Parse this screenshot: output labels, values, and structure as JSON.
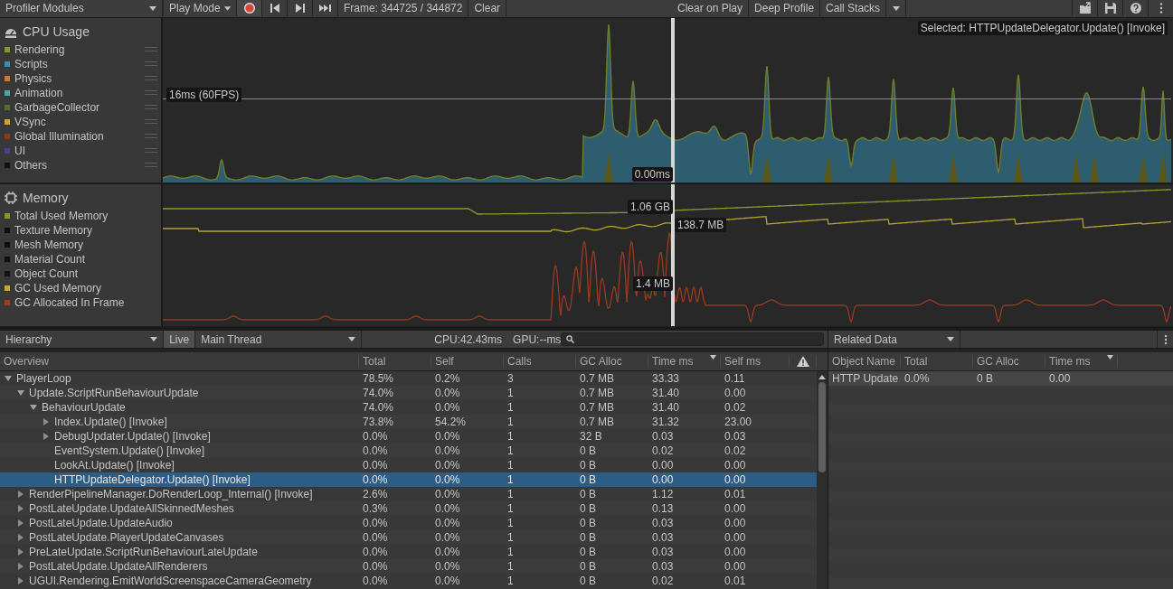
{
  "toolbar": {
    "modules_dropdown": "Profiler Modules",
    "target_dropdown": "Play Mode",
    "record": {
      "on": true
    },
    "frame": "Frame: 344725 / 344872",
    "clear": "Clear",
    "clear_on_play": "Clear on Play",
    "deep_profile": "Deep Profile",
    "call_stacks": "Call Stacks"
  },
  "modules": [
    {
      "kind": "cpu",
      "title": "CPU Usage",
      "legend": [
        {
          "label": "Rendering",
          "color": "#7f9a2a"
        },
        {
          "label": "Scripts",
          "color": "#3c8cb0"
        },
        {
          "label": "Physics",
          "color": "#c87a2a"
        },
        {
          "label": "Animation",
          "color": "#4ea6a6"
        },
        {
          "label": "GarbageCollector",
          "color": "#556b2f"
        },
        {
          "label": "VSync",
          "color": "#c9a82c"
        },
        {
          "label": "Global Illumination",
          "color": "#8b3a1a"
        },
        {
          "label": "UI",
          "color": "#4b3f8c"
        },
        {
          "label": "Others",
          "color": "#101010"
        }
      ],
      "labels": [
        {
          "kind": "threshold",
          "text": "16ms (60FPS)"
        },
        {
          "kind": "cursor_bottom",
          "text": "0.00ms"
        },
        {
          "kind": "selection",
          "text": "Selected: HTTPUpdateDelegator.Update() [Invoke]"
        }
      ]
    },
    {
      "kind": "memory",
      "title": "Memory",
      "legend": [
        {
          "label": "Total Used Memory",
          "color": "#7f9a2a"
        },
        {
          "label": "Texture Memory",
          "color": "#0d0d0d"
        },
        {
          "label": "Mesh Memory",
          "color": "#0e0e0e"
        },
        {
          "label": "Material Count",
          "color": "#0f0f0f"
        },
        {
          "label": "Object Count",
          "color": "#111111"
        },
        {
          "label": "GC Used Memory",
          "color": "#c9a82c"
        },
        {
          "label": "GC Allocated In Frame",
          "color": "#a33a1c"
        }
      ],
      "labels": [
        {
          "kind": "total_memory",
          "text": "1.06 GB"
        },
        {
          "kind": "gc_used",
          "text": "138.7 MB"
        },
        {
          "kind": "gc_alloc",
          "text": "1.4 MB"
        }
      ]
    }
  ],
  "hierarchy": {
    "view_dropdown": "Hierarchy",
    "live": {
      "label": "Live",
      "on": true
    },
    "thread_dropdown": "Main Thread",
    "cpu_time": "CPU:42.43ms",
    "gpu_time": "GPU:--ms",
    "columns": [
      {
        "label": "Overview",
        "sorted": false
      },
      {
        "label": "Total",
        "sorted": false
      },
      {
        "label": "Self",
        "sorted": false
      },
      {
        "label": "Calls",
        "sorted": false
      },
      {
        "label": "GC Alloc",
        "sorted": false
      },
      {
        "label": "Time ms",
        "sorted": true
      },
      {
        "label": "Self ms",
        "sorted": false
      }
    ],
    "rows": [
      {
        "cells": [
          "PlayerLoop",
          "78.5%",
          "0.2%",
          "3",
          "0.7 MB",
          "33.33",
          "0.11"
        ],
        "expandable": true,
        "expanded": true,
        "selected": false,
        "children": [
          {
            "cells": [
              "Update.ScriptRunBehaviourUpdate",
              "74.0%",
              "0.0%",
              "1",
              "0.7 MB",
              "31.40",
              "0.00"
            ],
            "expandable": true,
            "expanded": true,
            "selected": false,
            "children": [
              {
                "cells": [
                  "BehaviourUpdate",
                  "74.0%",
                  "0.0%",
                  "1",
                  "0.7 MB",
                  "31.40",
                  "0.02"
                ],
                "expandable": true,
                "expanded": true,
                "selected": false,
                "children": [
                  {
                    "cells": [
                      "Index.Update() [Invoke]",
                      "73.8%",
                      "54.2%",
                      "1",
                      "0.7 MB",
                      "31.32",
                      "23.00"
                    ],
                    "expandable": true,
                    "expanded": false,
                    "selected": false
                  },
                  {
                    "cells": [
                      "DebugUpdater.Update() [Invoke]",
                      "0.0%",
                      "0.0%",
                      "1",
                      "32 B",
                      "0.03",
                      "0.03"
                    ],
                    "expandable": true,
                    "expanded": false,
                    "selected": false
                  },
                  {
                    "cells": [
                      "EventSystem.Update() [Invoke]",
                      "0.0%",
                      "0.0%",
                      "1",
                      "0 B",
                      "0.02",
                      "0.02"
                    ],
                    "expandable": false,
                    "selected": false
                  },
                  {
                    "cells": [
                      "LookAt.Update() [Invoke]",
                      "0.0%",
                      "0.0%",
                      "1",
                      "0 B",
                      "0.00",
                      "0.00"
                    ],
                    "expandable": false,
                    "selected": false
                  },
                  {
                    "cells": [
                      "HTTPUpdateDelegator.Update() [Invoke]",
                      "0.0%",
                      "0.0%",
                      "1",
                      "0 B",
                      "0.00",
                      "0.00"
                    ],
                    "expandable": false,
                    "selected": true
                  }
                ]
              }
            ]
          },
          {
            "cells": [
              "RenderPipelineManager.DoRenderLoop_Internal() [Invoke]",
              "2.6%",
              "0.0%",
              "1",
              "0 B",
              "1.12",
              "0.01"
            ],
            "expandable": true,
            "expanded": false,
            "selected": false
          },
          {
            "cells": [
              "PostLateUpdate.UpdateAllSkinnedMeshes",
              "0.3%",
              "0.0%",
              "1",
              "0 B",
              "0.13",
              "0.00"
            ],
            "expandable": true,
            "expanded": false,
            "selected": false
          },
          {
            "cells": [
              "PostLateUpdate.UpdateAudio",
              "0.0%",
              "0.0%",
              "1",
              "0 B",
              "0.03",
              "0.00"
            ],
            "expandable": true,
            "expanded": false,
            "selected": false
          },
          {
            "cells": [
              "PostLateUpdate.PlayerUpdateCanvases",
              "0.0%",
              "0.0%",
              "1",
              "0 B",
              "0.03",
              "0.00"
            ],
            "expandable": true,
            "expanded": false,
            "selected": false
          },
          {
            "cells": [
              "PreLateUpdate.ScriptRunBehaviourLateUpdate",
              "0.0%",
              "0.0%",
              "1",
              "0 B",
              "0.03",
              "0.00"
            ],
            "expandable": true,
            "expanded": false,
            "selected": false
          },
          {
            "cells": [
              "PostLateUpdate.UpdateAllRenderers",
              "0.0%",
              "0.0%",
              "1",
              "0 B",
              "0.03",
              "0.00"
            ],
            "expandable": true,
            "expanded": false,
            "selected": false
          },
          {
            "cells": [
              "UGUI.Rendering.EmitWorldScreenspaceCameraGeometry",
              "0.0%",
              "0.0%",
              "1",
              "0 B",
              "0.02",
              "0.01"
            ],
            "expandable": true,
            "expanded": false,
            "selected": false
          }
        ]
      }
    ]
  },
  "related": {
    "dropdown": "Related Data",
    "columns": [
      {
        "label": "Object Name",
        "sorted": false
      },
      {
        "label": "Total",
        "sorted": false
      },
      {
        "label": "GC Alloc",
        "sorted": false
      },
      {
        "label": "Time ms",
        "sorted": true
      }
    ],
    "rows": [
      {
        "cells": [
          "HTTP Update",
          "0.0%",
          "0 B",
          "0.00"
        ]
      }
    ]
  }
}
